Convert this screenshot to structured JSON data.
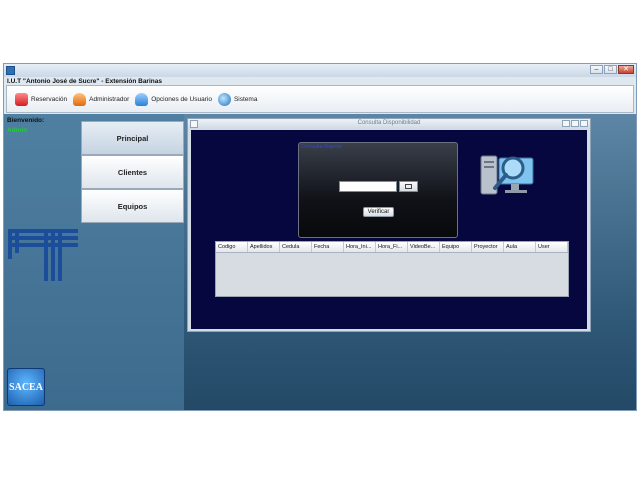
{
  "window": {
    "title_icon": "app-icon",
    "institution_title": "I.U.T \"Antonio José de Sucre\" - Extensión Barinas",
    "controls": {
      "minimize": "–",
      "maximize": "□",
      "close": "✕"
    }
  },
  "toolbar": {
    "items": [
      {
        "label": "Reservación",
        "icon": "reservation-icon"
      },
      {
        "label": "Administrador",
        "icon": "administrator-icon"
      },
      {
        "label": "Opciones de Usuario",
        "icon": "user-options-icon"
      },
      {
        "label": "Sistema",
        "icon": "system-icon"
      }
    ]
  },
  "sidebar": {
    "welcome_label": "Bienvenido:",
    "user": "Admin",
    "nav": [
      {
        "label": "Principal",
        "active": true
      },
      {
        "label": "Clientes",
        "active": false
      },
      {
        "label": "Equipos",
        "active": false
      }
    ],
    "logo_text": "SACEA"
  },
  "child_window": {
    "title": "Consulta Disponibilidad",
    "verify_panel": {
      "caption": "Consulta Rapida",
      "date_value": "",
      "verify_label": "Verificar"
    },
    "table": {
      "columns": [
        "Codigo",
        "Apellidos",
        "Cedula",
        "Fecha",
        "Hora_Ini...",
        "Hora_Fi...",
        "VideoBe...",
        "Equipo",
        "Proyector",
        "Aula",
        "User"
      ],
      "rows": []
    }
  },
  "colors": {
    "desktop": "#3f6f92",
    "child_body": "#06073e",
    "accent_user": "#1ecf2b"
  }
}
